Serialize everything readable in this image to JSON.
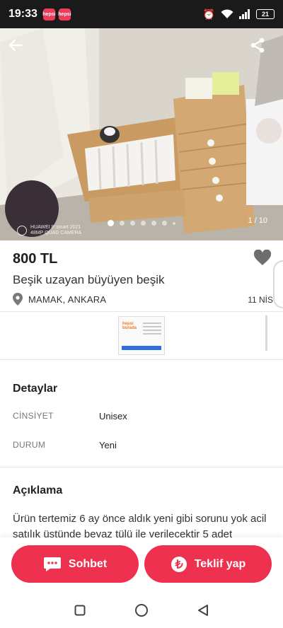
{
  "status_bar": {
    "time": "19:33",
    "app_badges": [
      "hepsi",
      "hepsi"
    ],
    "battery": "21"
  },
  "gallery": {
    "counter": "1 / 10",
    "page_dots": 7,
    "active_dot": 0,
    "watermark": {
      "line1": "HUAWEI P smart 2021",
      "line2": "48MP QUAD CAMERA"
    }
  },
  "listing": {
    "price": "800 TL",
    "title": "Beşik uzayan büyüyen beşik",
    "location": "MAMAK, ANKARA",
    "date": "11 NİS"
  },
  "ad": {
    "logo_line1": "hepsi",
    "logo_line2": "burada"
  },
  "details": {
    "heading": "Detaylar",
    "rows": [
      {
        "key": "CİNSİYET",
        "value": "Unisex"
      },
      {
        "key": "DURUM",
        "value": "Yeni"
      }
    ]
  },
  "description": {
    "heading": "Açıklama",
    "text": "Ürün tertemiz 6 ay önce aldık yeni gibi sorunu yok acil satılık üstünde beyaz tülü ile verilecektir 5 adet"
  },
  "actions": {
    "chat_label": "Sohbet",
    "offer_label": "Teklif yap"
  },
  "colors": {
    "accent": "#ef3150",
    "status_bar": "#1a1a1a"
  },
  "icons": {
    "back": "arrow-left-icon",
    "share": "share-icon",
    "favorite": "heart-icon",
    "location": "location-pin-icon",
    "chat": "chat-bubble-icon",
    "offer": "lira-icon"
  }
}
